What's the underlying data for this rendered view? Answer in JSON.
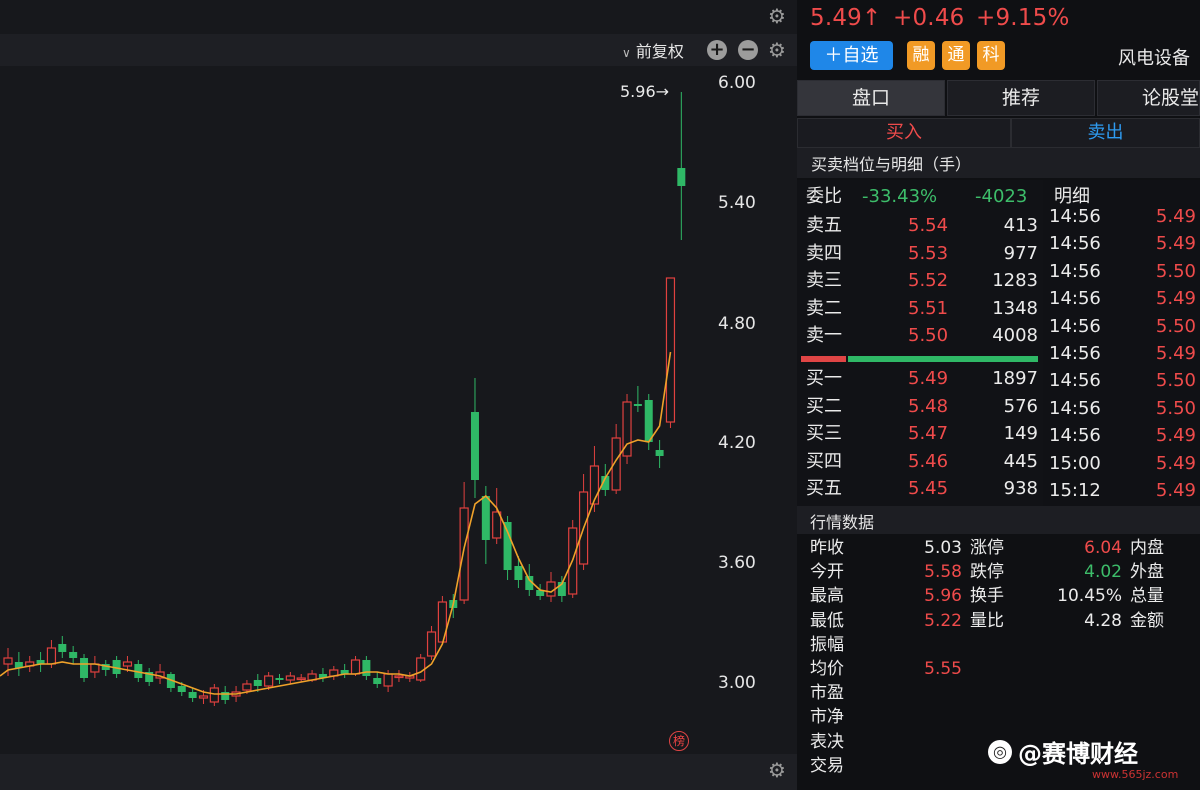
{
  "toolbar": {
    "adjust_label": "前复权",
    "plus_label": "+",
    "minus_label": "−"
  },
  "chart_data": {
    "type": "candlestick",
    "yticks": [
      "6.00",
      "5.40",
      "4.80",
      "4.20",
      "3.60",
      "3.00"
    ],
    "ylim": [
      2.9,
      6.1
    ],
    "high_marker": "5.96→",
    "rank_badge": "榜",
    "candles": [
      {
        "o": 3.1,
        "c": 3.13,
        "h": 3.18,
        "l": 3.04
      },
      {
        "o": 3.11,
        "c": 3.08,
        "h": 3.16,
        "l": 3.04
      },
      {
        "o": 3.09,
        "c": 3.11,
        "h": 3.14,
        "l": 3.06
      },
      {
        "o": 3.12,
        "c": 3.1,
        "h": 3.16,
        "l": 3.06
      },
      {
        "o": 3.1,
        "c": 3.18,
        "h": 3.22,
        "l": 3.08
      },
      {
        "o": 3.2,
        "c": 3.16,
        "h": 3.24,
        "l": 3.13
      },
      {
        "o": 3.16,
        "c": 3.13,
        "h": 3.19,
        "l": 3.1
      },
      {
        "o": 3.13,
        "c": 3.03,
        "h": 3.15,
        "l": 3.01
      },
      {
        "o": 3.06,
        "c": 3.1,
        "h": 3.14,
        "l": 3.03
      },
      {
        "o": 3.1,
        "c": 3.07,
        "h": 3.12,
        "l": 3.04
      },
      {
        "o": 3.12,
        "c": 3.05,
        "h": 3.14,
        "l": 3.03
      },
      {
        "o": 3.09,
        "c": 3.11,
        "h": 3.14,
        "l": 3.06
      },
      {
        "o": 3.1,
        "c": 3.03,
        "h": 3.12,
        "l": 3.01
      },
      {
        "o": 3.06,
        "c": 3.01,
        "h": 3.08,
        "l": 2.99
      },
      {
        "o": 3.03,
        "c": 3.06,
        "h": 3.1,
        "l": 3.0
      },
      {
        "o": 3.05,
        "c": 2.98,
        "h": 3.06,
        "l": 2.96
      },
      {
        "o": 2.99,
        "c": 2.96,
        "h": 3.01,
        "l": 2.94
      },
      {
        "o": 2.96,
        "c": 2.93,
        "h": 2.98,
        "l": 2.91
      },
      {
        "o": 2.93,
        "c": 2.94,
        "h": 2.97,
        "l": 2.9
      },
      {
        "o": 2.91,
        "c": 2.98,
        "h": 3.0,
        "l": 2.89
      },
      {
        "o": 2.96,
        "c": 2.92,
        "h": 2.99,
        "l": 2.9
      },
      {
        "o": 2.94,
        "c": 2.96,
        "h": 2.99,
        "l": 2.91
      },
      {
        "o": 2.97,
        "c": 3.0,
        "h": 3.02,
        "l": 2.95
      },
      {
        "o": 3.02,
        "c": 2.99,
        "h": 3.05,
        "l": 2.96
      },
      {
        "o": 2.99,
        "c": 3.04,
        "h": 3.06,
        "l": 2.97
      },
      {
        "o": 3.03,
        "c": 3.02,
        "h": 3.05,
        "l": 3.0
      },
      {
        "o": 3.02,
        "c": 3.04,
        "h": 3.06,
        "l": 3.0
      },
      {
        "o": 3.03,
        "c": 3.03,
        "h": 3.05,
        "l": 3.01
      },
      {
        "o": 3.02,
        "c": 3.05,
        "h": 3.07,
        "l": 3.01
      },
      {
        "o": 3.05,
        "c": 3.03,
        "h": 3.08,
        "l": 3.01
      },
      {
        "o": 3.04,
        "c": 3.07,
        "h": 3.09,
        "l": 3.02
      },
      {
        "o": 3.07,
        "c": 3.05,
        "h": 3.1,
        "l": 3.03
      },
      {
        "o": 3.05,
        "c": 3.12,
        "h": 3.14,
        "l": 3.04
      },
      {
        "o": 3.12,
        "c": 3.04,
        "h": 3.14,
        "l": 3.02
      },
      {
        "o": 3.03,
        "c": 3.0,
        "h": 3.06,
        "l": 2.98
      },
      {
        "o": 2.99,
        "c": 3.05,
        "h": 3.07,
        "l": 2.96
      },
      {
        "o": 3.04,
        "c": 3.04,
        "h": 3.07,
        "l": 3.01
      },
      {
        "o": 3.03,
        "c": 3.04,
        "h": 3.06,
        "l": 3.01
      },
      {
        "o": 3.02,
        "c": 3.13,
        "h": 3.15,
        "l": 3.01
      },
      {
        "o": 3.14,
        "c": 3.26,
        "h": 3.29,
        "l": 3.12
      },
      {
        "o": 3.21,
        "c": 3.41,
        "h": 3.44,
        "l": 3.2
      },
      {
        "o": 3.42,
        "c": 3.38,
        "h": 3.45,
        "l": 3.33
      },
      {
        "o": 3.42,
        "c": 3.88,
        "h": 4.01,
        "l": 3.4
      },
      {
        "o": 4.36,
        "c": 4.02,
        "h": 4.53,
        "l": 3.93
      },
      {
        "o": 3.94,
        "c": 3.72,
        "h": 3.99,
        "l": 3.6
      },
      {
        "o": 3.73,
        "c": 3.86,
        "h": 3.98,
        "l": 3.7
      },
      {
        "o": 3.81,
        "c": 3.57,
        "h": 3.84,
        "l": 3.52
      },
      {
        "o": 3.59,
        "c": 3.52,
        "h": 3.64,
        "l": 3.48
      },
      {
        "o": 3.54,
        "c": 3.47,
        "h": 3.6,
        "l": 3.44
      },
      {
        "o": 3.47,
        "c": 3.44,
        "h": 3.5,
        "l": 3.42
      },
      {
        "o": 3.44,
        "c": 3.51,
        "h": 3.56,
        "l": 3.41
      },
      {
        "o": 3.51,
        "c": 3.44,
        "h": 3.54,
        "l": 3.41
      },
      {
        "o": 3.45,
        "c": 3.78,
        "h": 3.82,
        "l": 3.43
      },
      {
        "o": 3.6,
        "c": 3.96,
        "h": 4.05,
        "l": 3.57
      },
      {
        "o": 3.9,
        "c": 4.09,
        "h": 4.19,
        "l": 3.86
      },
      {
        "o": 4.04,
        "c": 3.97,
        "h": 4.1,
        "l": 3.94
      },
      {
        "o": 3.97,
        "c": 4.23,
        "h": 4.3,
        "l": 3.95
      },
      {
        "o": 4.14,
        "c": 4.41,
        "h": 4.45,
        "l": 4.1
      },
      {
        "o": 4.4,
        "c": 4.39,
        "h": 4.49,
        "l": 4.36
      },
      {
        "o": 4.42,
        "c": 4.21,
        "h": 4.45,
        "l": 4.17
      },
      {
        "o": 4.17,
        "c": 4.14,
        "h": 4.22,
        "l": 4.08
      },
      {
        "o": 4.31,
        "c": 5.03,
        "h": 5.03,
        "l": 4.28
      },
      {
        "o": 5.58,
        "c": 5.49,
        "h": 5.96,
        "l": 5.22
      }
    ],
    "ma": [
      3.07,
      3.08,
      3.09,
      3.1,
      3.1,
      3.11,
      3.1,
      3.1,
      3.1,
      3.09,
      3.08,
      3.07,
      3.06,
      3.05,
      3.04,
      3.02,
      3.0,
      2.98,
      2.96,
      2.95,
      2.95,
      2.95,
      2.96,
      2.97,
      2.98,
      2.99,
      3.0,
      3.01,
      3.02,
      3.03,
      3.04,
      3.05,
      3.05,
      3.06,
      3.06,
      3.05,
      3.05,
      3.04,
      3.06,
      3.1,
      3.2,
      3.4,
      3.68,
      3.9,
      3.94,
      3.88,
      3.76,
      3.63,
      3.52,
      3.47,
      3.46,
      3.5,
      3.62,
      3.78,
      3.92,
      4.03,
      4.12,
      4.2,
      4.22,
      4.21,
      4.29,
      4.66
    ]
  },
  "quote": {
    "price": "5.49↑",
    "change": "+0.46",
    "pct": "+9.15%",
    "add_watch": "＋自选",
    "tags": [
      "融",
      "通",
      "科"
    ],
    "sector": "风电设备"
  },
  "tabs": [
    "盘口",
    "推荐",
    "论股堂"
  ],
  "trade": {
    "buy": "买入",
    "sell": "卖出"
  },
  "orderbook": {
    "title": "买卖档位与明细（手）",
    "ratio_label": "委比",
    "ratio_pct": "-33.43%",
    "ratio_val": "-4023",
    "detail_label": "明细",
    "asks": [
      {
        "label": "卖五",
        "price": "5.54",
        "vol": "413"
      },
      {
        "label": "卖四",
        "price": "5.53",
        "vol": "977"
      },
      {
        "label": "卖三",
        "price": "5.52",
        "vol": "1283"
      },
      {
        "label": "卖二",
        "price": "5.51",
        "vol": "1348"
      },
      {
        "label": "卖一",
        "price": "5.50",
        "vol": "4008"
      }
    ],
    "bids": [
      {
        "label": "买一",
        "price": "5.49",
        "vol": "1897"
      },
      {
        "label": "买二",
        "price": "5.48",
        "vol": "576"
      },
      {
        "label": "买三",
        "price": "5.47",
        "vol": "149"
      },
      {
        "label": "买四",
        "price": "5.46",
        "vol": "445"
      },
      {
        "label": "买五",
        "price": "5.45",
        "vol": "938"
      }
    ],
    "balance": {
      "red": 0.2,
      "green": 0.8
    },
    "ticks": [
      {
        "t": "14:56",
        "p": "5.49"
      },
      {
        "t": "14:56",
        "p": "5.49"
      },
      {
        "t": "14:56",
        "p": "5.50"
      },
      {
        "t": "14:56",
        "p": "5.49"
      },
      {
        "t": "14:56",
        "p": "5.50"
      },
      {
        "t": "14:56",
        "p": "5.49"
      },
      {
        "t": "14:56",
        "p": "5.50"
      },
      {
        "t": "14:56",
        "p": "5.50"
      },
      {
        "t": "14:56",
        "p": "5.49"
      },
      {
        "t": "15:00",
        "p": "5.49"
      },
      {
        "t": "15:12",
        "p": "5.49"
      }
    ]
  },
  "market": {
    "title": "行情数据",
    "rows": [
      {
        "l1": "昨收",
        "v1": "5.03",
        "l2": "涨停",
        "v2": "6.04",
        "l3": "内盘"
      },
      {
        "l1": "今开",
        "v1": "5.58",
        "l2": "跌停",
        "v2": "4.02",
        "l3": "外盘"
      },
      {
        "l1": "最高",
        "v1": "5.96",
        "l2": "换手",
        "v2": "10.45%",
        "l3": "总量"
      },
      {
        "l1": "最低",
        "v1": "5.22",
        "l2": "量比",
        "v2": "4.28",
        "l3": "金额"
      },
      {
        "l1": "振幅",
        "v1": "",
        "l2": "",
        "v2": "",
        "l3": ""
      },
      {
        "l1": "均价",
        "v1": "5.55",
        "l2": "",
        "v2": "",
        "l3": ""
      },
      {
        "l1": "市盈",
        "v1": "",
        "l2": "",
        "v2": "",
        "l3": ""
      },
      {
        "l1": "市净",
        "v1": "",
        "l2": "",
        "v2": "",
        "l3": ""
      },
      {
        "l1": "表决",
        "v1": "",
        "l2": "",
        "v2": "",
        "l3": ""
      },
      {
        "l1": "交易",
        "v1": "",
        "l2": "",
        "v2": "",
        "l3": ""
      }
    ]
  },
  "watermark": {
    "brand": "@赛博财经",
    "url": "www.565jz.com"
  }
}
